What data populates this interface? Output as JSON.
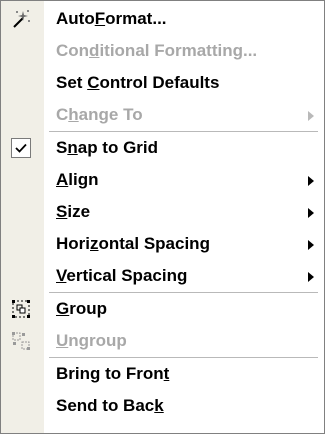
{
  "menu": {
    "items": [
      {
        "pre": "Auto",
        "acc": "F",
        "post": "ormat...",
        "icon": "autoformat-wand-icon",
        "disabled": false
      },
      {
        "pre": "Con",
        "acc": "d",
        "post": "itional Formatting...",
        "disabled": true
      },
      {
        "pre": "Set ",
        "acc": "C",
        "post": "ontrol Defaults",
        "disabled": false
      },
      {
        "pre": "C",
        "acc": "h",
        "post": "ange To",
        "disabled": true,
        "submenu": true
      },
      {
        "pre": "S",
        "acc": "n",
        "post": "ap to Grid",
        "disabled": false,
        "checked": true,
        "icon": "checkmark-icon"
      },
      {
        "pre": "",
        "acc": "A",
        "post": "lign",
        "disabled": false,
        "submenu": true
      },
      {
        "pre": "",
        "acc": "S",
        "post": "ize",
        "disabled": false,
        "submenu": true
      },
      {
        "pre": "Hori",
        "acc": "z",
        "post": "ontal Spacing",
        "disabled": false,
        "submenu": true
      },
      {
        "pre": "",
        "acc": "V",
        "post": "ertical Spacing",
        "disabled": false,
        "submenu": true
      },
      {
        "pre": "",
        "acc": "G",
        "post": "roup",
        "disabled": false,
        "icon": "group-icon"
      },
      {
        "pre": "",
        "acc": "U",
        "post": "ngroup",
        "disabled": true,
        "icon": "ungroup-icon"
      },
      {
        "pre": "Bring to Fron",
        "acc": "t",
        "post": "",
        "disabled": false
      },
      {
        "pre": "Send to Bac",
        "acc": "k",
        "post": "",
        "disabled": false
      }
    ],
    "colors": {
      "gutter": "#f1efe7",
      "disabled_text": "#a8a8a8",
      "separator": "#b9b9b9"
    }
  }
}
